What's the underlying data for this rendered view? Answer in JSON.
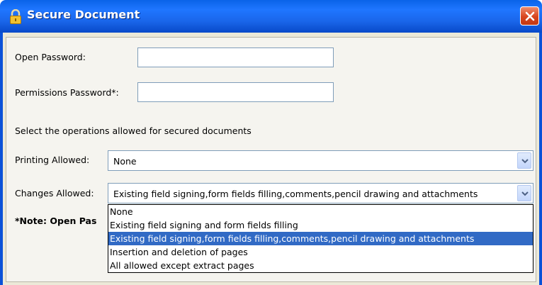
{
  "window": {
    "title": "Secure Document"
  },
  "fields": {
    "open_password_label": "Open Password:",
    "open_password_value": "",
    "permissions_password_label": "Permissions Password*:",
    "permissions_password_value": ""
  },
  "section_text": "Select the operations allowed for secured documents",
  "printing": {
    "label": "Printing Allowed:",
    "selected": "None"
  },
  "changes": {
    "label": "Changes Allowed:",
    "selected": "Existing field signing,form fields filling,comments,pencil drawing and attachments",
    "options": [
      "None",
      "Existing field signing and form fields filling",
      "Existing field signing,form fields filling,comments,pencil drawing and attachments",
      "Insertion and deletion of pages",
      "All allowed except extract pages"
    ],
    "highlighted_index": 2
  },
  "note": "*Note: Open Pas",
  "colors": {
    "titlebar": "#1f76ff",
    "selection": "#316ac5",
    "close_button": "#d8451e"
  },
  "icons": {
    "title": "lock-icon",
    "close": "close-icon",
    "dropdown": "chevron-down-icon"
  }
}
